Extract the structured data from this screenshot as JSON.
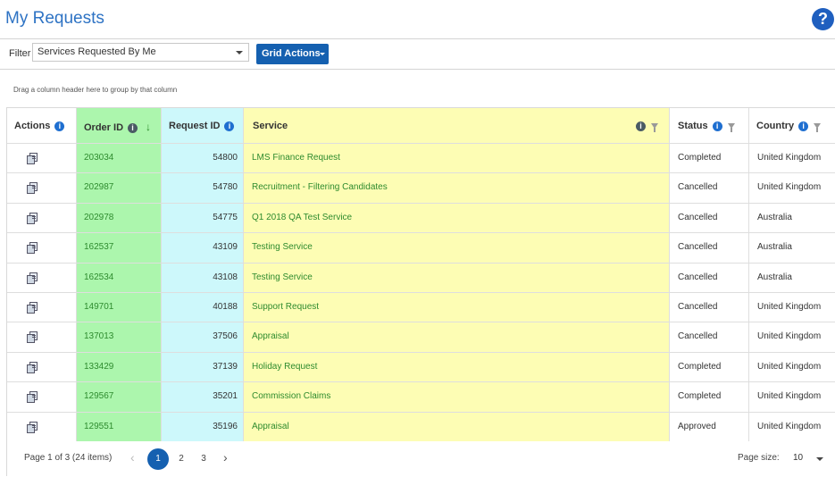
{
  "page": {
    "title": "My Requests",
    "help_icon_glyph": "?"
  },
  "toolbar": {
    "filter_label": "Filter",
    "filter_value": "Services Requested By Me",
    "grid_actions_label": "Grid Actions"
  },
  "group_hint": "Drag a column header here to group by that column",
  "columns": {
    "actions": "Actions",
    "order_id": "Order ID",
    "request_id": "Request ID",
    "service": "Service",
    "status": "Status",
    "country": "Country"
  },
  "rows": [
    {
      "order_id": "203034",
      "request_id": "54800",
      "service": "LMS Finance Request",
      "status": "Completed",
      "country": "United Kingdom"
    },
    {
      "order_id": "202987",
      "request_id": "54780",
      "service": "Recruitment - Filtering Candidates",
      "status": "Cancelled",
      "country": "United Kingdom"
    },
    {
      "order_id": "202978",
      "request_id": "54775",
      "service": "Q1 2018 QA Test Service",
      "status": "Cancelled",
      "country": "Australia"
    },
    {
      "order_id": "162537",
      "request_id": "43109",
      "service": "Testing Service",
      "status": "Cancelled",
      "country": "Australia"
    },
    {
      "order_id": "162534",
      "request_id": "43108",
      "service": "Testing Service",
      "status": "Cancelled",
      "country": "Australia"
    },
    {
      "order_id": "149701",
      "request_id": "40188",
      "service": "Support Request",
      "status": "Cancelled",
      "country": "United Kingdom"
    },
    {
      "order_id": "137013",
      "request_id": "37506",
      "service": "Appraisal",
      "status": "Cancelled",
      "country": "United Kingdom"
    },
    {
      "order_id": "133429",
      "request_id": "37139",
      "service": "Holiday Request",
      "status": "Completed",
      "country": "United Kingdom"
    },
    {
      "order_id": "129567",
      "request_id": "35201",
      "service": "Commission Claims",
      "status": "Completed",
      "country": "United Kingdom"
    },
    {
      "order_id": "129551",
      "request_id": "35196",
      "service": "Appraisal",
      "status": "Approved",
      "country": "United Kingdom"
    }
  ],
  "pager": {
    "info": "Page 1 of 3 (24 items)",
    "pages": [
      "1",
      "2",
      "3"
    ],
    "current_page": "1",
    "prev_glyph": "‹",
    "next_glyph": "›",
    "page_size_label": "Page size:",
    "page_size_value": "10"
  },
  "colors": {
    "order_col": "#acf6ad",
    "request_col": "#cdf8fb",
    "service_col": "#fdfdb4",
    "accent": "#1560b0"
  }
}
